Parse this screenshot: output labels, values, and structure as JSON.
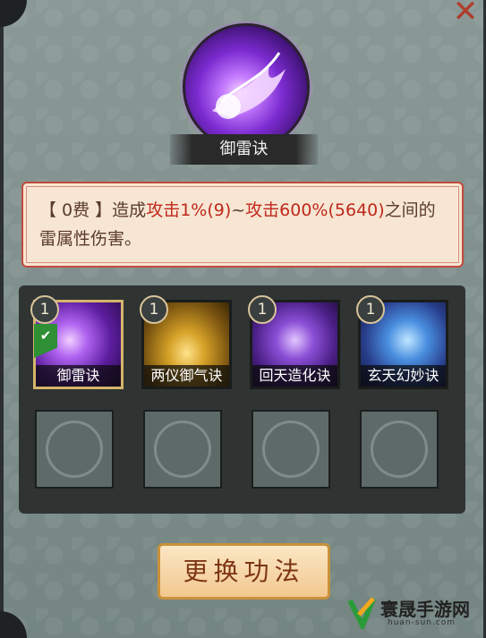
{
  "header": {
    "close_icon": "close-x-icon",
    "skill_icon": "purple-lightning-orb-icon",
    "skill_title": "御雷诀"
  },
  "description": {
    "cost": "【 0费 】",
    "text_1": "造成",
    "atk_min": "攻击1%(9)",
    "tilde": "~",
    "atk_max": "攻击600%(5640)",
    "text_2": "之间的雷属性伤害。"
  },
  "skills": [
    {
      "level": "1",
      "name": "御雷诀",
      "selected": true,
      "icon": "purple-lightning-icon"
    },
    {
      "level": "1",
      "name": "两仪御气诀",
      "selected": false,
      "icon": "golden-yinyang-icon"
    },
    {
      "level": "1",
      "name": "回天造化诀",
      "selected": false,
      "icon": "purple-robe-figure-icon"
    },
    {
      "level": "1",
      "name": "玄天幻妙诀",
      "selected": false,
      "icon": "blue-sword-icon"
    }
  ],
  "empty_slots": 4,
  "change_button": "更换功法",
  "watermark": {
    "text": "寰晟手游网",
    "url": "huan-sun.com"
  },
  "colors": {
    "accent_red": "#c0281b",
    "panel_dark": "#2f3433",
    "selected_border": "#d6b46a"
  }
}
